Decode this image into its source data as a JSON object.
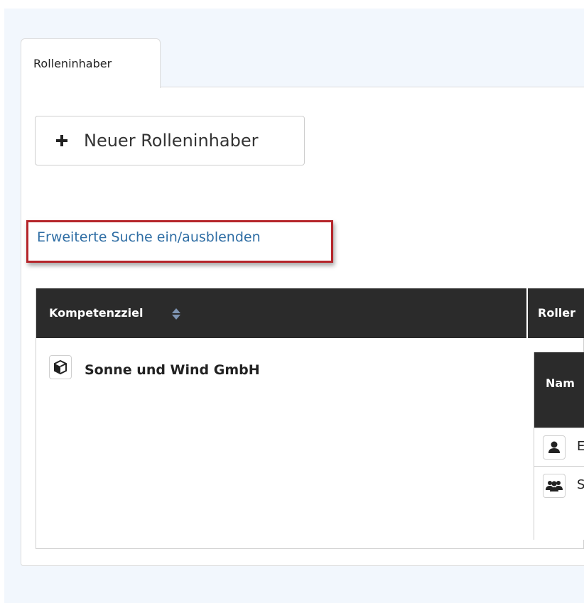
{
  "tabs": [
    {
      "label": "Rolleninhaber",
      "active": true
    }
  ],
  "toolbar": {
    "new_button_label": "Neuer Rolleninhaber",
    "new_button_icon": "plus-icon"
  },
  "search_toggle": {
    "label": "Erweiterte Suche ein/ausblenden",
    "highlight_color": "#b5252a"
  },
  "table": {
    "columns": [
      {
        "label": "Kompetenzziel",
        "sortable": true
      },
      {
        "label": "Roller"
      }
    ],
    "rows": [
      {
        "icon": "cube-icon",
        "name": "Sonne und Wind GmbH",
        "nested": {
          "columns": [
            {
              "label": "Nam"
            }
          ],
          "rows": [
            {
              "icon": "user-icon",
              "text": "E"
            },
            {
              "icon": "group-icon",
              "text": "S"
            }
          ]
        }
      }
    ]
  },
  "colors": {
    "header_bg": "#2b2b2b",
    "link": "#2e6da4",
    "page_bg": "#f2f7fd"
  }
}
